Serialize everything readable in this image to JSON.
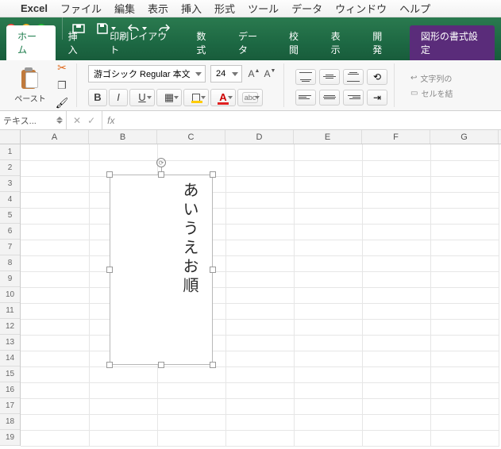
{
  "mac_menu": {
    "app_name": "Excel",
    "items": [
      "ファイル",
      "編集",
      "表示",
      "挿入",
      "形式",
      "ツール",
      "データ",
      "ウィンドウ",
      "ヘルプ"
    ]
  },
  "ribbon_tabs": {
    "items": [
      "ホーム",
      "挿入",
      "印刷レイアウト",
      "数式",
      "データ",
      "校閲",
      "表示",
      "開発"
    ],
    "active_index": 0,
    "context_tab": "図形の書式設定"
  },
  "paste": {
    "label": "ペースト"
  },
  "font": {
    "name": "游ゴシック Regular 本文",
    "size": "24",
    "bold": "B",
    "italic": "I",
    "underline": "U",
    "abc": "abc"
  },
  "right_panel": {
    "wrap_label": "文字列の",
    "merge_label": "セルを結"
  },
  "name_box": {
    "value": "テキス..."
  },
  "formula_bar": {
    "fx": "fx",
    "value": ""
  },
  "columns": [
    "A",
    "B",
    "C",
    "D",
    "E",
    "F",
    "G"
  ],
  "rows": [
    "1",
    "2",
    "3",
    "4",
    "5",
    "6",
    "7",
    "8",
    "9",
    "10",
    "11",
    "12",
    "13",
    "14",
    "15",
    "16",
    "17",
    "18",
    "19"
  ],
  "shape": {
    "text": "あいうえお順"
  }
}
